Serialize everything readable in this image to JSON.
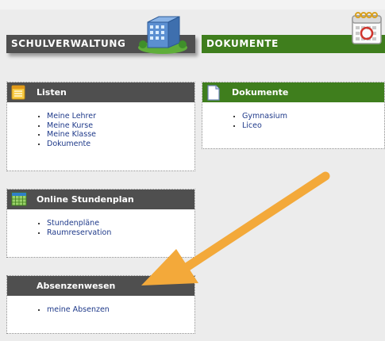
{
  "header": {
    "school_admin_label": "SCHULVERWALTUNG",
    "documents_label": "DOKUMENTE"
  },
  "panels": {
    "listen": {
      "title": "Listen",
      "items": [
        "Meine Lehrer",
        "Meine Kurse",
        "Meine Klasse",
        "Dokumente"
      ]
    },
    "dokumente": {
      "title": "Dokumente",
      "items": [
        "Gymnasium",
        "Liceo"
      ]
    },
    "stundenplan": {
      "title": "Online Stundenplan",
      "items": [
        "Stundenpläne",
        "Raumreservation"
      ]
    },
    "absenzen": {
      "title": "Absenzenwesen",
      "items": [
        "meine Absenzen"
      ]
    }
  },
  "colors": {
    "header_grey": "#4f4f4f",
    "header_green": "#3f7e1d",
    "link_blue": "#1f3a8a",
    "arrow_orange": "#f3a93a"
  }
}
